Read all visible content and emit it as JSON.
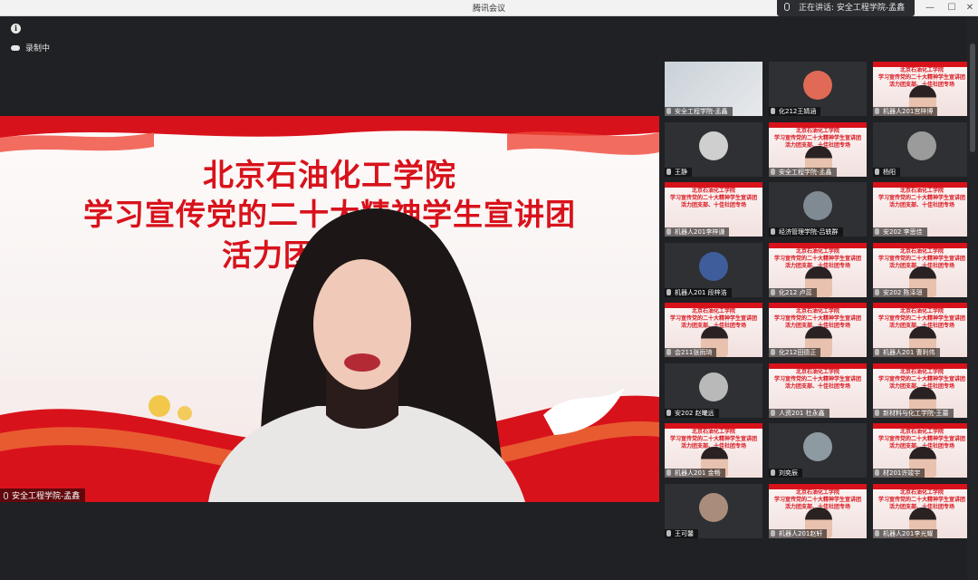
{
  "window": {
    "title": "腾讯会议",
    "controls": [
      "—",
      "☐",
      "✕"
    ]
  },
  "speaker": {
    "label": "正在讲话: 安全工程学院-孟鑫"
  },
  "status": {
    "recording": "录制中"
  },
  "slide": {
    "line1": "北京石油化工学院",
    "line2": "学习宣传党的二十大精神学生宣讲团",
    "line3": "活力团支部专场"
  },
  "thumb_slide": {
    "line1": "北京石油化工学院",
    "line2": "学习宣传党的二十大精神学生宣讲团",
    "line3": "活力团支部、十佳社团专场"
  },
  "main_participant": "安全工程学院-孟鑫",
  "participants": [
    {
      "name": "安全工程学院-孟鑫",
      "kind": "photo"
    },
    {
      "name": "化212王婧涵",
      "kind": "avatar",
      "color": "#e06a55"
    },
    {
      "name": "机器人201宫梓博",
      "kind": "slide-face"
    },
    {
      "name": "王静",
      "kind": "avatar",
      "color": "#cfcfcf"
    },
    {
      "name": "安全工程学院-孟鑫",
      "kind": "slide-face"
    },
    {
      "name": "杨阳",
      "kind": "avatar",
      "color": "#9b9b9b"
    },
    {
      "name": "机器人201李梓谦",
      "kind": "slide"
    },
    {
      "name": "经济管理学院-吕轶群",
      "kind": "avatar",
      "color": "#7f8a92"
    },
    {
      "name": "安202 李思佳",
      "kind": "slide"
    },
    {
      "name": "机器人201 段梓浩",
      "kind": "avatar",
      "color": "#3f5d9a"
    },
    {
      "name": "化212 卢蕊",
      "kind": "slide-face"
    },
    {
      "name": "安202 陈泽璟",
      "kind": "slide-face"
    },
    {
      "name": "会211张雨琦",
      "kind": "slide-face"
    },
    {
      "name": "化212田德正",
      "kind": "slide-face"
    },
    {
      "name": "机器人201 曹利伟",
      "kind": "slide-face"
    },
    {
      "name": "安202 赵曦远",
      "kind": "avatar",
      "color": "#b9b9b9"
    },
    {
      "name": "人资201 杜永鑫",
      "kind": "slide"
    },
    {
      "name": "新材料与化工学院-王蕾",
      "kind": "slide-face"
    },
    {
      "name": "机器人201 金畅",
      "kind": "slide-face"
    },
    {
      "name": "刘奕辰",
      "kind": "avatar",
      "color": "#8e9aa1"
    },
    {
      "name": "材201许竣宇",
      "kind": "slide-face"
    },
    {
      "name": "王可馨",
      "kind": "avatar",
      "color": "#a98d7a"
    },
    {
      "name": "机器人201赵轩",
      "kind": "slide-face"
    },
    {
      "name": "机器人201李光耀",
      "kind": "slide-face"
    }
  ]
}
